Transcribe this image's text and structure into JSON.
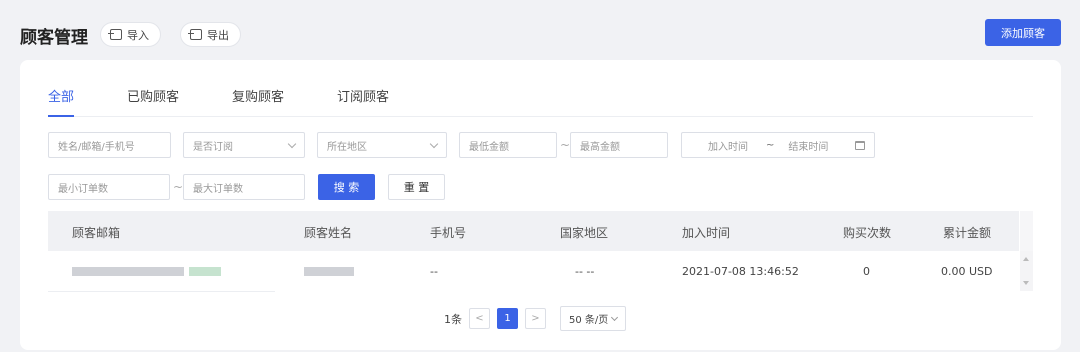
{
  "header": {
    "title": "顾客管理",
    "import_label": "导入",
    "export_label": "导出",
    "add_label": "添加顾客"
  },
  "tabs": [
    {
      "label": "全部"
    },
    {
      "label": "已购顾客"
    },
    {
      "label": "复购顾客"
    },
    {
      "label": "订阅顾客"
    }
  ],
  "filters": {
    "name_placeholder": "姓名/邮箱/手机号",
    "subscribed": "是否订阅",
    "region": "所在地区",
    "min_amount": "最低金额",
    "max_amount": "最高金额",
    "start_time": "加入时间",
    "end_time": "结束时间",
    "min_orders": "最小订单数",
    "max_orders": "最大订单数",
    "range_sep": "~",
    "search_label": "搜 索",
    "reset_label": "重 置"
  },
  "table": {
    "columns": [
      "顾客邮箱",
      "顾客姓名",
      "手机号",
      "国家地区",
      "加入时间",
      "购买次数",
      "累计金额"
    ],
    "rows": [
      {
        "phone": "--",
        "region": "-- --",
        "joined": "2021-07-08 13:46:52",
        "purchases": "0",
        "total": "0.00 USD"
      }
    ]
  },
  "pagination": {
    "total": "1条",
    "prev": "<",
    "current": "1",
    "next": ">",
    "page_size": "50 条/页"
  }
}
